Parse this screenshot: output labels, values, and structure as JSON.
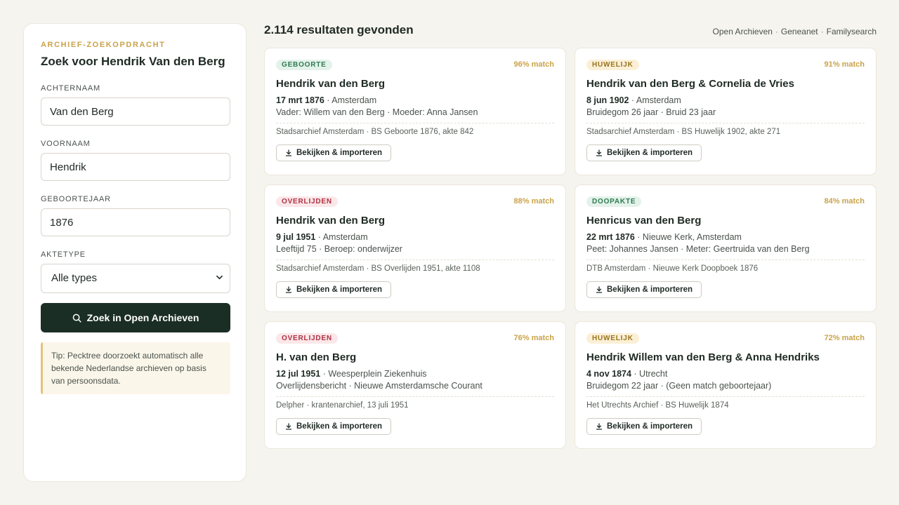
{
  "panel": {
    "eyebrow": "ARCHIEF-ZOEKOPDRACHT",
    "title": "Zoek voor Hendrik Van den Berg",
    "fields": [
      {
        "label": "ACHTERNAAM",
        "value": "Van den Berg"
      },
      {
        "label": "VOORNAAM",
        "value": "Hendrik"
      },
      {
        "label": "GEBOORTEJAAR",
        "value": "1876"
      }
    ],
    "type_label": "AKTETYPE",
    "type_value": "Alle types",
    "search_button": "Zoek in Open Archieven",
    "tip": "Tip: Pecktree doorzoekt automatisch alle bekende Nederlandse archieven op basis van persoonsdata."
  },
  "results": {
    "count_text": "2.114 resultaten gevonden",
    "sources": [
      "Open Archieven",
      "Geneanet",
      "Familysearch"
    ],
    "source_separator": "·",
    "button_label": "Bekijken & importeren",
    "cards": [
      {
        "badge": "GEBOORTE",
        "badge_color": "#2f7a52",
        "match": "96% match",
        "name": "Hendrik van den Berg",
        "date": "17 mrt 1876",
        "place": " · Amsterdam",
        "detail": "Vader: Willem van den Berg · Moeder: Anna Jansen",
        "source": "Stadsarchief Amsterdam · BS Geboorte 1876, akte 842"
      },
      {
        "badge": "HUWELIJK",
        "badge_color": "#9a7420",
        "match": "91% match",
        "name": "Hendrik van den Berg & Cornelia de Vries",
        "date": "8 jun 1902",
        "place": " · Amsterdam",
        "detail": "Bruidegom 26 jaar · Bruid 23 jaar",
        "source": "Stadsarchief Amsterdam · BS Huwelijk 1902, akte 271"
      },
      {
        "badge": "OVERLIJDEN",
        "badge_color": "#b03041",
        "match": "88% match",
        "name": "Hendrik van den Berg",
        "date": "9 jul 1951",
        "place": " · Amsterdam",
        "detail": "Leeftijd 75 · Beroep: onderwijzer",
        "source": "Stadsarchief Amsterdam · BS Overlijden 1951, akte 1108"
      },
      {
        "badge": "DOOPAKTE",
        "badge_color": "#2f7a52",
        "match": "84% match",
        "name": "Henricus van den Berg",
        "date": "22 mrt 1876",
        "place": " · Nieuwe Kerk, Amsterdam",
        "detail": "Peet: Johannes Jansen · Meter: Geertruida van den Berg",
        "source": "DTB Amsterdam · Nieuwe Kerk Doopboek 1876"
      },
      {
        "badge": "OVERLIJDEN",
        "badge_color": "#b03041",
        "match": "76% match",
        "name": "H. van den Berg",
        "date": "12 jul 1951",
        "place": " · Weesperplein Ziekenhuis",
        "detail": "Overlijdensbericht · Nieuwe Amsterdamsche Courant",
        "source": "Delpher · krantenarchief, 13 juli 1951"
      },
      {
        "badge": "HUWELIJK",
        "badge_color": "#9a7420",
        "match": "72% match",
        "name": "Hendrik Willem van den Berg & Anna Hendriks",
        "date": "4 nov 1874",
        "place": " · Utrecht",
        "detail": "Bruidegom 22 jaar · (Geen match geboortejaar)",
        "source": "Het Utrechts Archief · BS Huwelijk 1874"
      }
    ]
  }
}
